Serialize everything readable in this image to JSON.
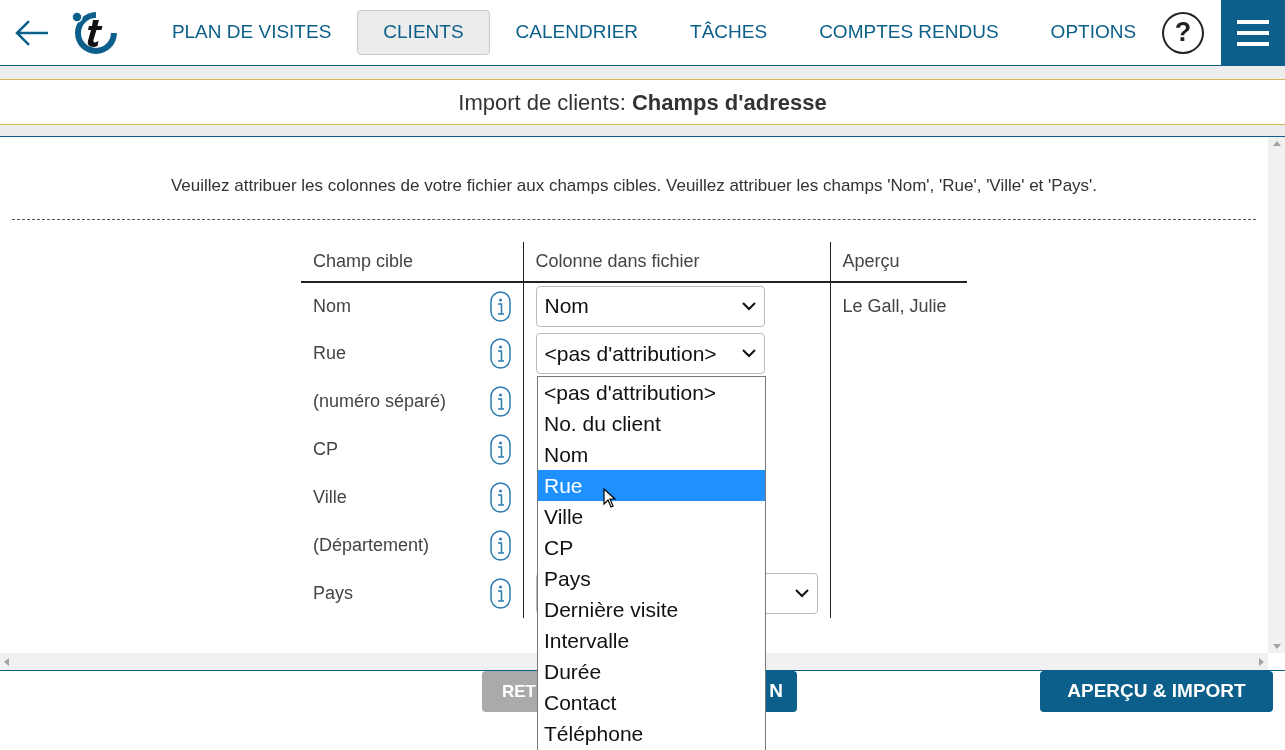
{
  "nav": {
    "items": [
      {
        "label": "PLAN DE VISITES",
        "selected": false
      },
      {
        "label": "CLIENTS",
        "selected": true
      },
      {
        "label": "CALENDRIER",
        "selected": false
      },
      {
        "label": "TÂCHES",
        "selected": false
      },
      {
        "label": "COMPTES RENDUS",
        "selected": false
      },
      {
        "label": "OPTIONS",
        "selected": false
      }
    ],
    "help": "?"
  },
  "title": {
    "prefix": "Import de clients: ",
    "main": "Champs d'adresse"
  },
  "instructions": "Veuillez attribuer les colonnes de votre fichier aux champs cibles. Veuillez attribuer les champs 'Nom', 'Rue', 'Ville' et 'Pays'.",
  "table": {
    "columns": [
      "Champ cible",
      "Colonne dans fichier",
      "Aperçu"
    ],
    "rows": [
      {
        "field": "Nom",
        "kind": "select",
        "value": "Nom",
        "preview": "Le Gall, Julie"
      },
      {
        "field": "Rue",
        "kind": "open",
        "value": "<pas d'attribution>"
      },
      {
        "field": "(numéro séparé)",
        "kind": "covered"
      },
      {
        "field": "CP",
        "kind": "covered"
      },
      {
        "field": "Ville",
        "kind": "covered"
      },
      {
        "field": "(Département)",
        "kind": "covered"
      },
      {
        "field": "Pays",
        "kind": "partial"
      }
    ]
  },
  "dropdown": {
    "options": [
      {
        "label": "<pas d'attribution>",
        "selected": false
      },
      {
        "label": "No. du client",
        "selected": false
      },
      {
        "label": "Nom",
        "selected": false
      },
      {
        "label": "Rue",
        "selected": true
      },
      {
        "label": "Ville",
        "selected": false
      },
      {
        "label": "CP",
        "selected": false
      },
      {
        "label": "Pays",
        "selected": false
      },
      {
        "label": "Dernière visite",
        "selected": false
      },
      {
        "label": "Intervalle",
        "selected": false
      },
      {
        "label": "Durée",
        "selected": false
      },
      {
        "label": "Contact",
        "selected": false
      },
      {
        "label": "Téléphone",
        "selected": false
      }
    ]
  },
  "footer": {
    "buttons": [
      {
        "label_start": "RET",
        "disabled": true
      },
      {
        "label_end": "N",
        "disabled": false
      },
      {
        "label_start": "APERÇU & IMPORT",
        "disabled": false
      }
    ]
  }
}
